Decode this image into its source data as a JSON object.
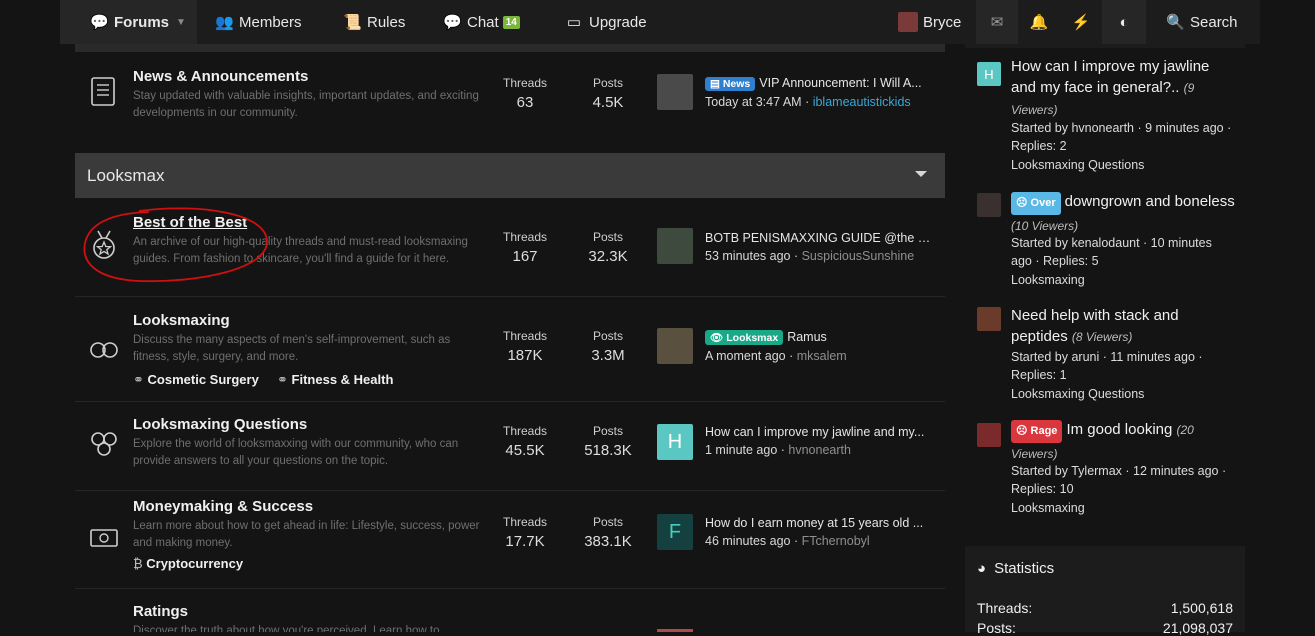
{
  "nav": {
    "forums": "Forums",
    "members": "Members",
    "rules": "Rules",
    "chat": "Chat",
    "chat_badge": "14",
    "upgrade": "Upgrade",
    "user": "Bryce",
    "search": "Search"
  },
  "forums_top": {
    "title": "News & Announcements",
    "desc": "Stay updated with valuable insights, important updates, and exciting developments in our community.",
    "threads_label": "Threads",
    "threads": "63",
    "posts_label": "Posts",
    "posts": "4.5K",
    "prefix": "News",
    "last_title": "VIP Announcement: I Will A...",
    "last_time": "Today at 3:47 AM",
    "last_sep": " · ",
    "last_user": "iblameautistickids"
  },
  "category": {
    "title": "Looksmax"
  },
  "nodes": [
    {
      "title": "Best of the Best",
      "desc": "An archive of our high-quality threads and must-read looksmaxing guides. From fashion to skincare, you'll find a guide for it here.",
      "threads_label": "Threads",
      "threads": "167",
      "posts_label": "Posts",
      "posts": "32.3K",
      "last_title": "BOTB PENISMAXXING GUIDE @the B...",
      "last_time": "53 minutes ago",
      "last_sep": " · ",
      "last_user": "SuspiciousSunshine"
    },
    {
      "title": "Looksmaxing",
      "desc": "Discuss the many aspects of men's self-improvement, such as fitness, style, surgery, and more.",
      "sub1": "Cosmetic Surgery",
      "sub2": "Fitness & Health",
      "threads_label": "Threads",
      "threads": "187K",
      "posts_label": "Posts",
      "posts": "3.3M",
      "prefix": "Looksmax",
      "last_title": "Ramus",
      "last_time": "A moment ago",
      "last_sep": " · ",
      "last_user": "mksalem"
    },
    {
      "title": "Looksmaxing Questions",
      "desc": "Explore the world of looksmaxxing with our community, who can provide answers to all your questions on the topic.",
      "threads_label": "Threads",
      "threads": "45.5K",
      "posts_label": "Posts",
      "posts": "518.3K",
      "avatar_letter": "H",
      "last_title": "How can I improve my jawline and my...",
      "last_time": "1 minute ago",
      "last_sep": " · ",
      "last_user": "hvnonearth"
    },
    {
      "title": "Moneymaking & Success",
      "desc": "Learn more about how to get ahead in life: Lifestyle, success, power and making money.",
      "sub1": "Cryptocurrency",
      "threads_label": "Threads",
      "threads": "17.7K",
      "posts_label": "Posts",
      "posts": "383.1K",
      "avatar_letter": "F",
      "last_title": "How do I earn money at 15 years old ...",
      "last_time": "46 minutes ago",
      "last_sep": " · ",
      "last_user": "FTchernobyl"
    },
    {
      "title": "Ratings",
      "desc": "Discover the truth about how you're perceived. Learn how to"
    }
  ],
  "sidebar": {
    "threads": [
      {
        "avatar_letter": "H",
        "title": "How can I improve my jawline and my face in general?..",
        "viewers": "(9 Viewers)",
        "started": "Started by hvnonearth · 9 minutes ago · Replies: 2",
        "forum": "Looksmaxing Questions"
      },
      {
        "prefix": "Over",
        "title": "downgrown and boneless",
        "viewers": "(10 Viewers)",
        "started": "Started by kenalodaunt · 10 minutes ago · Replies: 5",
        "forum": "Looksmaxing"
      },
      {
        "title": "Need help with stack and peptides",
        "viewers": "(8 Viewers)",
        "started": "Started by aruni · 11 minutes ago · Replies: 1",
        "forum": "Looksmaxing Questions"
      },
      {
        "prefix": "Rage",
        "title": "Im good looking",
        "viewers": "(20 Viewers)",
        "started": "Started by Tylermax · 12 minutes ago · Replies: 10",
        "forum": "Looksmaxing"
      }
    ],
    "statistics": {
      "title": "Statistics",
      "threads_label": "Threads:",
      "threads": "1,500,618",
      "posts_label": "Posts:",
      "posts": "21,098,037"
    }
  },
  "colors": {
    "accent_link": "#39a8d8",
    "prefix_news": "#2f7fd1",
    "prefix_looksmax": "#1aa888",
    "prefix_over": "#5ab8e6",
    "prefix_rage": "#d9363e",
    "annotation": "#d01010"
  }
}
